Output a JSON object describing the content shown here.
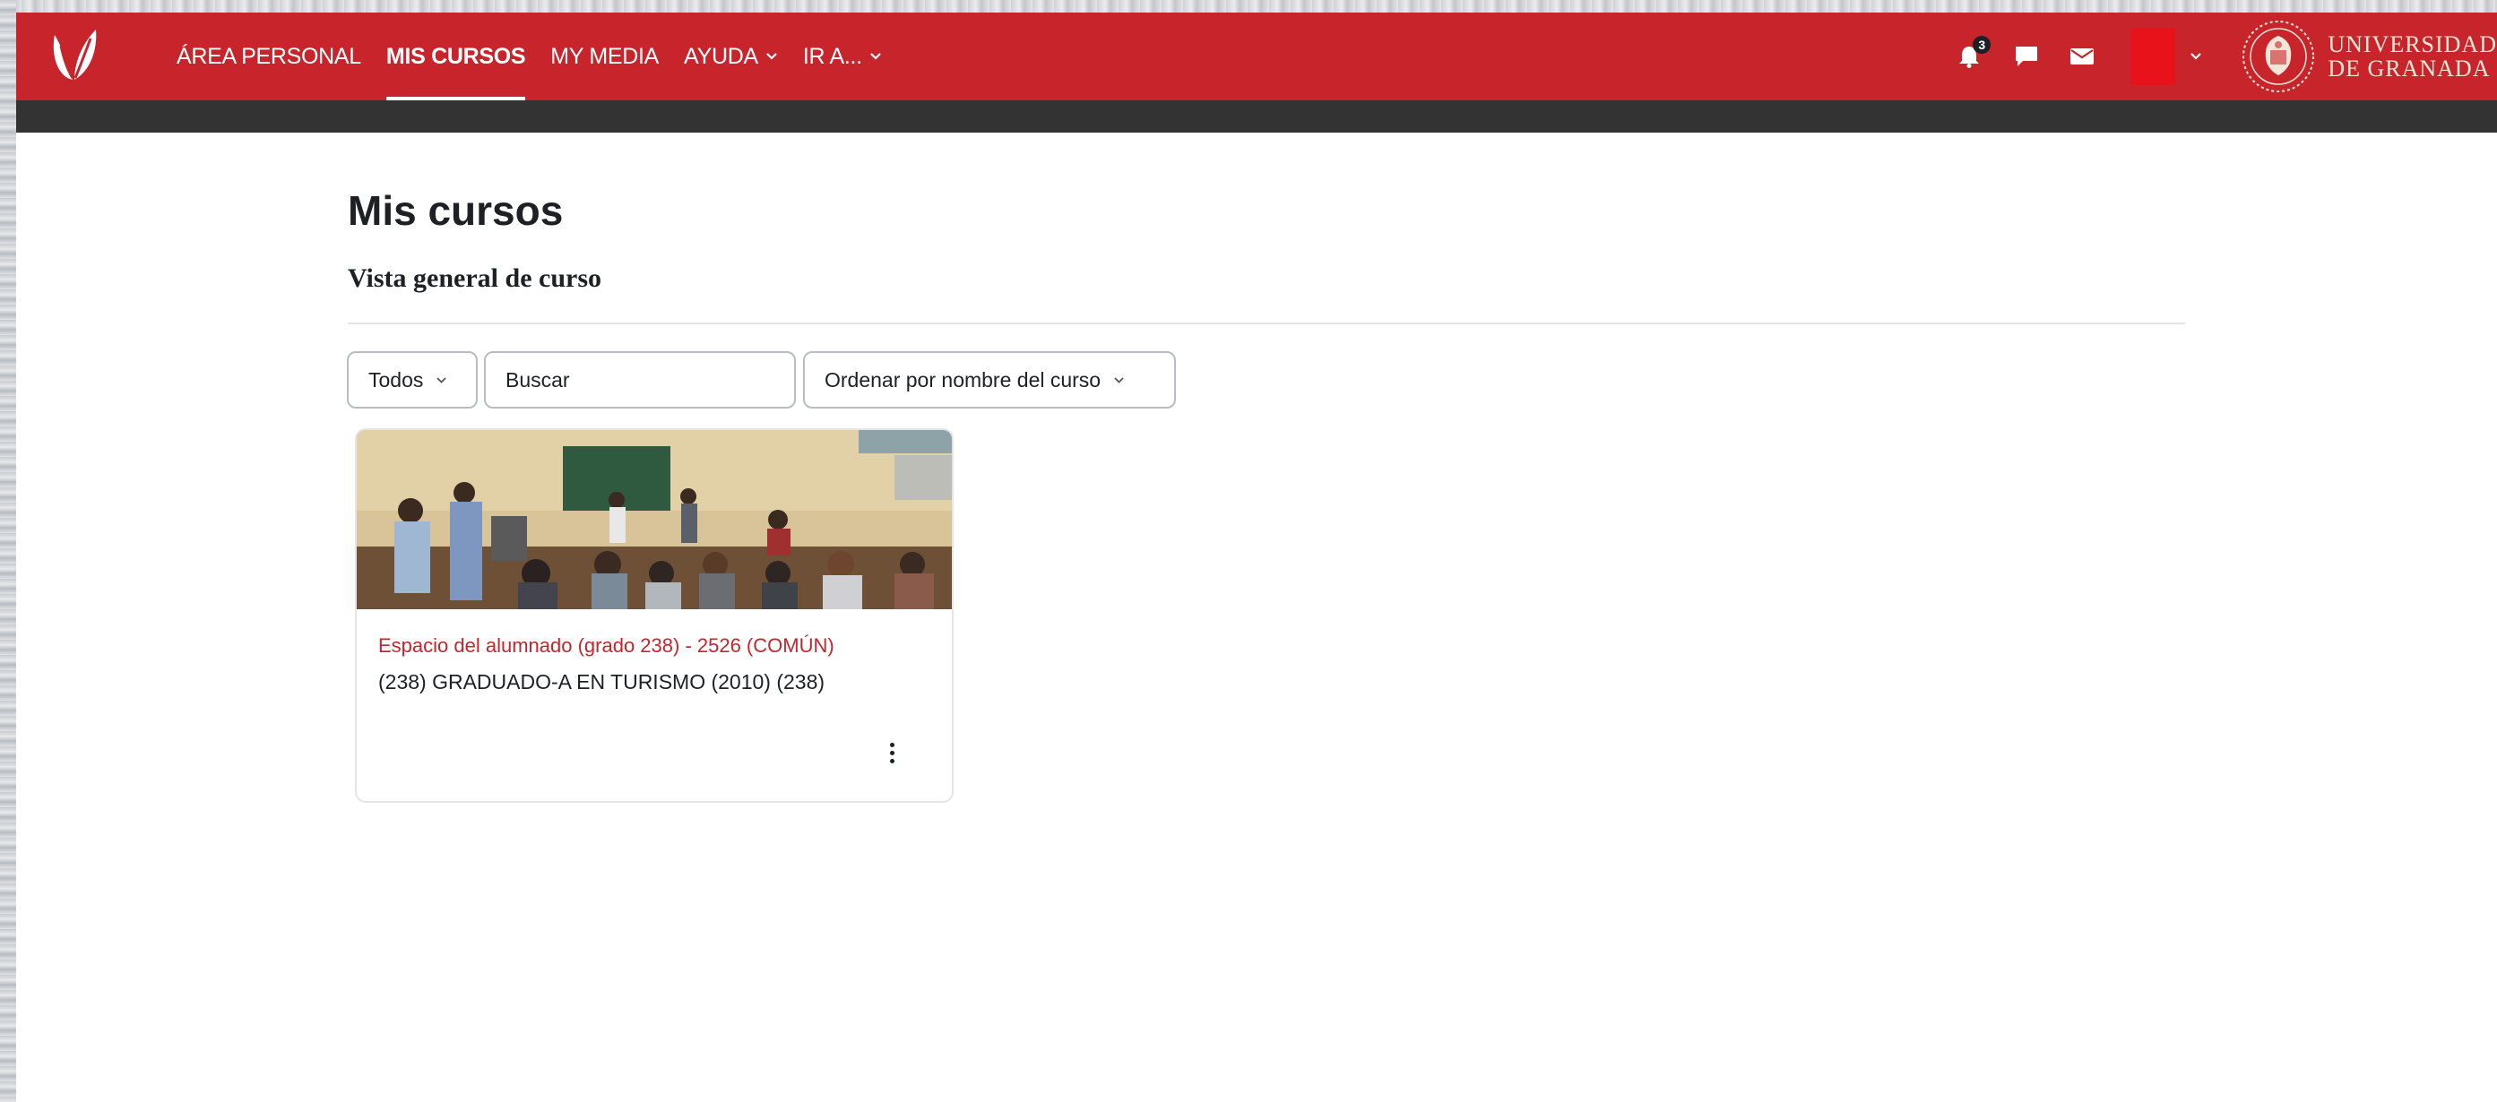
{
  "colors": {
    "brand_red": "#c8242c",
    "subbar": "#333333",
    "text": "#1d2125",
    "course_link": "#c8242c"
  },
  "navbar": {
    "logo_icon": "leaf-logo-icon",
    "items": [
      {
        "label": "ÁREA PERSONAL",
        "active": false,
        "dropdown": false
      },
      {
        "label": "MIS CURSOS",
        "active": true,
        "dropdown": false
      },
      {
        "label": "MY MEDIA",
        "active": false,
        "dropdown": false
      },
      {
        "label": "AYUDA",
        "active": false,
        "dropdown": true
      },
      {
        "label": "IR A...",
        "active": false,
        "dropdown": true
      }
    ],
    "notifications_count": "3",
    "icons": [
      "bell-icon",
      "chat-icon",
      "envelope-icon",
      "chevron-down-icon"
    ],
    "university_line1": "UNIVERSIDAD",
    "university_line2": "DE GRANADA"
  },
  "main": {
    "page_title": "Mis cursos",
    "block_title": "Vista general de curso",
    "filters": {
      "grouping_label": "Todos",
      "search_placeholder": "Buscar",
      "sort_label": "Ordenar por nombre del curso"
    },
    "courses": [
      {
        "name": "Espacio del alumnado (grado 238) - 2526 (COMÚN)",
        "category": "(238) GRADUADO-A EN TURISMO (2010) (238)",
        "image": "classroom-photo"
      }
    ]
  }
}
